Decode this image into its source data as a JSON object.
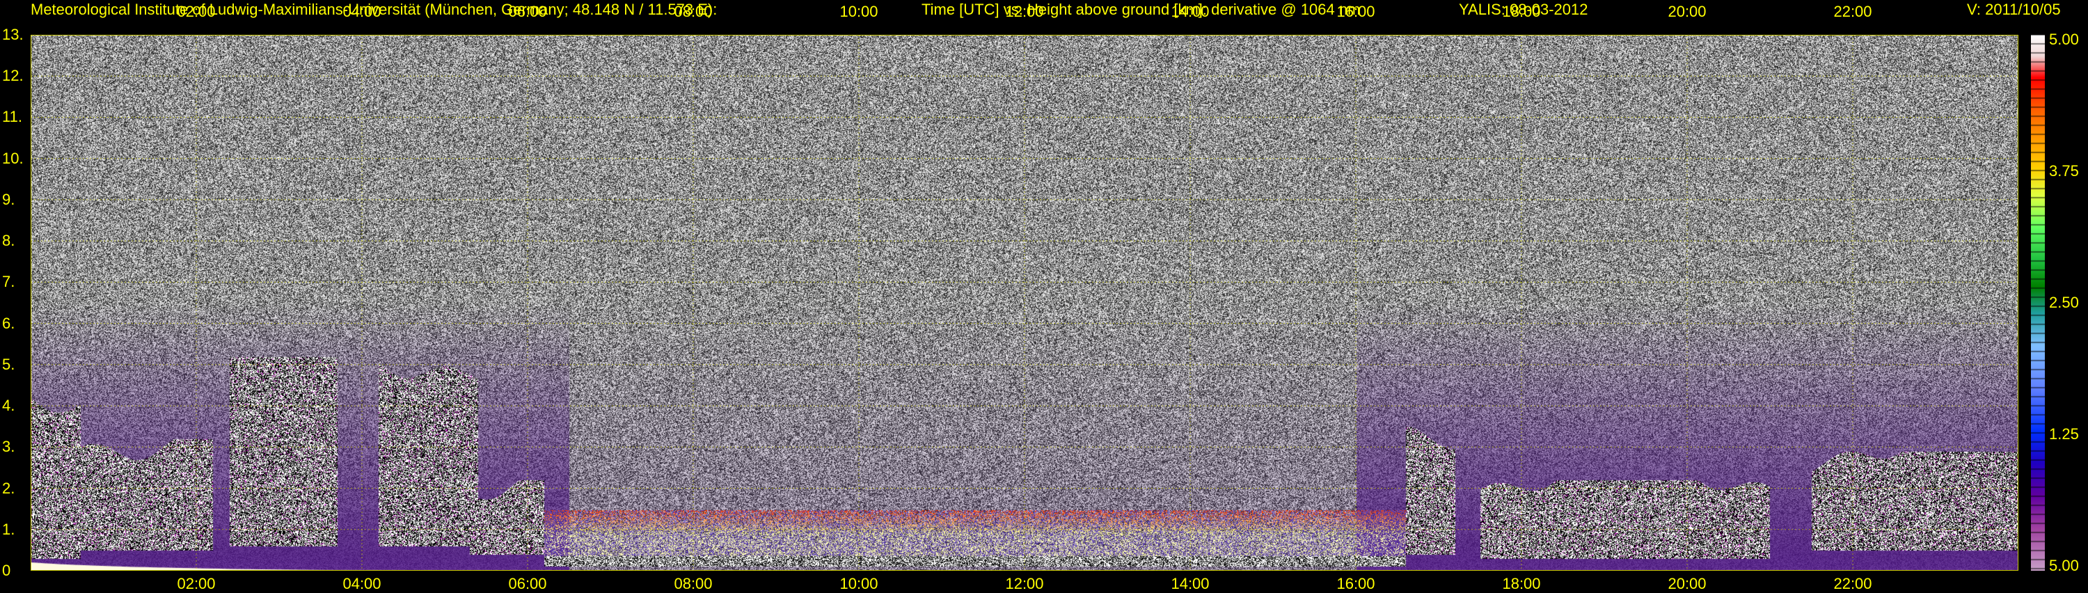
{
  "header": {
    "institute": "Meteorological Institute of Ludwig-Maximilians-Universität (München, Germany; 48.148 N / 11.573 E):",
    "axes_description": "Time [UTC] vs. Height above ground [km]: derivative @ 1064 nm",
    "instrument_date": "YALIS: 08-03-2012",
    "version": "V: 2011/10/05"
  },
  "chart_data": {
    "type": "heatmap",
    "x_ticks": [
      "02:00",
      "04:00",
      "06:00",
      "08:00",
      "10:00",
      "12:00",
      "14:00",
      "16:00",
      "18:00",
      "20:00",
      "22:00"
    ],
    "x_tick_hours": [
      2,
      4,
      6,
      8,
      10,
      12,
      14,
      16,
      18,
      20,
      22
    ],
    "xlim_hours": [
      0,
      24
    ],
    "y_ticks": [
      "0",
      "1.",
      "2.",
      "3.",
      "4.",
      "5.",
      "6.",
      "7.",
      "8.",
      "9.",
      "10.",
      "11.",
      "12.",
      "13."
    ],
    "y_tick_values": [
      0,
      1,
      2,
      3,
      4,
      5,
      6,
      7,
      8,
      9,
      10,
      11,
      12,
      13
    ],
    "ylim_km": [
      0,
      13
    ],
    "colorbar_labels": [
      "5.00",
      "3.75",
      "2.50",
      "1.25",
      "5.00"
    ],
    "grid": true,
    "grid_color": "#c8c800",
    "text_color": "#ffff00",
    "cloud_regions": [
      {
        "start_h": 0.0,
        "end_h": 0.6,
        "bottom_km": 0.3,
        "top_km": 4.2
      },
      {
        "start_h": 0.6,
        "end_h": 2.2,
        "bottom_km": 0.5,
        "top_km": 3.2
      },
      {
        "start_h": 2.4,
        "end_h": 3.7,
        "bottom_km": 0.6,
        "top_km": 5.2
      },
      {
        "start_h": 4.2,
        "end_h": 5.4,
        "bottom_km": 0.6,
        "top_km": 5.1
      },
      {
        "start_h": 5.3,
        "end_h": 6.2,
        "bottom_km": 0.4,
        "top_km": 2.2
      },
      {
        "start_h": 16.6,
        "end_h": 17.2,
        "bottom_km": 0.4,
        "top_km": 3.5
      },
      {
        "start_h": 17.5,
        "end_h": 21.0,
        "bottom_km": 0.3,
        "top_km": 2.2
      },
      {
        "start_h": 21.5,
        "end_h": 24.0,
        "bottom_km": 0.5,
        "top_km": 2.9
      }
    ],
    "boundary_layer": {
      "start_h": 6.2,
      "end_h": 16.6,
      "top_km": 0.8
    }
  }
}
